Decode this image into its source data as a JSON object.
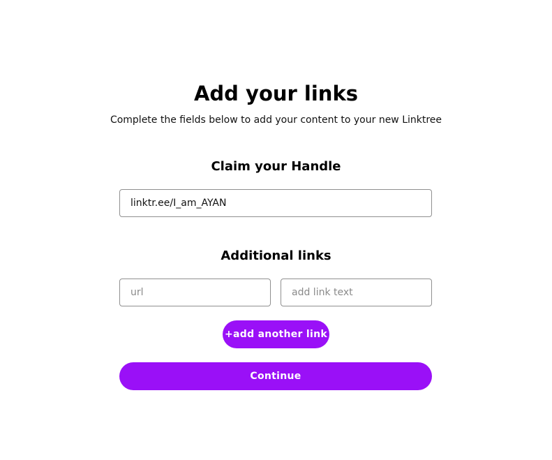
{
  "header": {
    "title": "Add your links",
    "subtitle": "Complete the fields below to add your content to your new Linktree"
  },
  "handle_section": {
    "heading": "Claim your Handle",
    "handle_value": "linktr.ee/I_am_AYAN"
  },
  "links_section": {
    "heading": "Additional links",
    "url_placeholder": "url",
    "url_value": "",
    "text_placeholder": "add link text",
    "text_value": "",
    "add_button_label": "+add another link"
  },
  "actions": {
    "continue_label": "Continue"
  },
  "colors": {
    "accent": "#9a10f7",
    "border": "#8f8f8f",
    "background": "#ffffff"
  }
}
